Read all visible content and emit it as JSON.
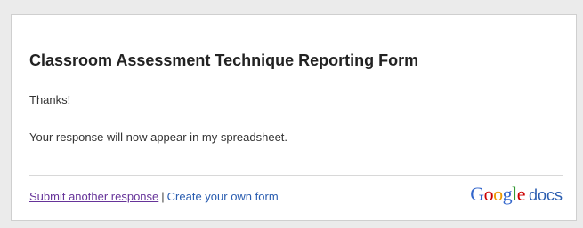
{
  "form": {
    "title": "Classroom Assessment Technique Reporting Form",
    "thanks_message": "Thanks!",
    "confirmation_message": "Your response will now appear in my spreadsheet."
  },
  "footer": {
    "submit_another_label": "Submit another response",
    "separator": "|",
    "create_form_label": "Create your own form",
    "brand": {
      "letters": [
        {
          "char": "G",
          "color": "#3366cc"
        },
        {
          "char": "o",
          "color": "#cc0000"
        },
        {
          "char": "o",
          "color": "#ee9900"
        },
        {
          "char": "g",
          "color": "#3366cc"
        },
        {
          "char": "l",
          "color": "#339933"
        },
        {
          "char": "e",
          "color": "#cc0000"
        }
      ],
      "product": "docs"
    }
  },
  "colors": {
    "background": "#ebebeb",
    "card": "#ffffff",
    "visited_link": "#663399",
    "link": "#2a5db0"
  }
}
